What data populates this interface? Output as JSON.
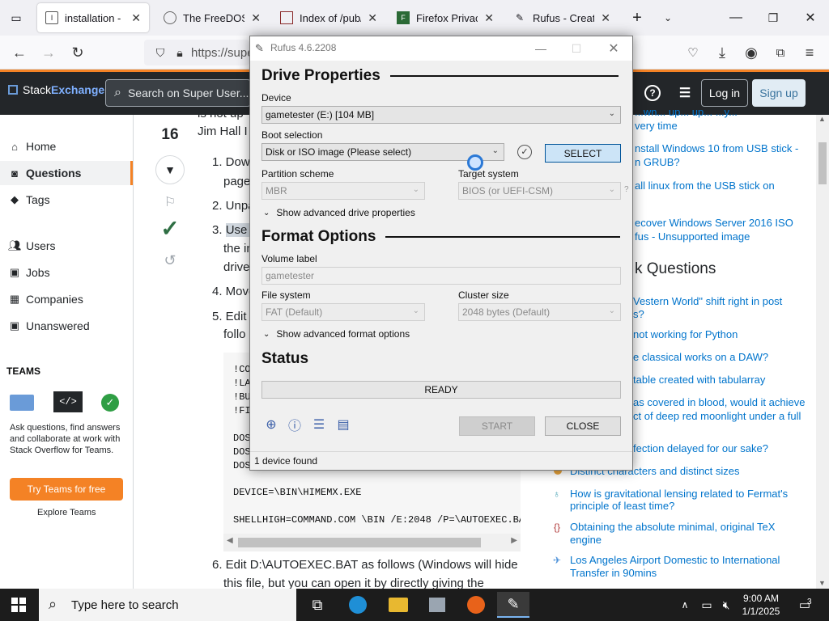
{
  "browser": {
    "tabs": [
      {
        "label": "installation - How",
        "active": true
      },
      {
        "label": "The FreeDOS Proj"
      },
      {
        "label": "Index of /pub/mi"
      },
      {
        "label": "Firefox Privacy N"
      },
      {
        "label": "Rufus - Create bo"
      }
    ],
    "url": "https://supe"
  },
  "site": {
    "brand": "Stack",
    "brand2": "Exchange",
    "search_placeholder": "Search on Super User...",
    "login": "Log in",
    "signup": "Sign up",
    "nav": {
      "home": "Home",
      "questions": "Questions",
      "tags": "Tags",
      "users": "Users",
      "jobs": "Jobs",
      "companies": "Companies",
      "unanswered": "Unanswered"
    },
    "teams": {
      "heading": "TEAMS",
      "text": "Ask questions, find answers and collaborate at work with Stack Overflow for Teams.",
      "button": "Try Teams for free",
      "explore": "Explore Teams"
    }
  },
  "question": {
    "vote_count": "16",
    "top_line1": "is not up",
    "top_line2": "Jim Hall I",
    "steps": {
      "s1a": "1. Down",
      "s1b": "page",
      "s2": "2. Unpa",
      "s3a": "3.",
      "s3sel": "Use a",
      "s3b": "the in",
      "s3c": "drive",
      "s4": "4. Move",
      "s5a": "5. Edit t",
      "s5b": "follo",
      "s6a": "6. Edit D:\\AUTOEXEC.BAT as follows (Windows will hide",
      "s6b": "this file, but you can open it by directly giving the"
    },
    "code": [
      "!CO",
      "!LA",
      "!BU",
      "!FI",
      "DOS",
      "DOS",
      "DOS",
      "DEVICE=\\BIN\\HIMEMX.EXE",
      "SHELLHIGH=COMMAND.COM \\BIN /E:2048 /P=\\AUTOEXEC.BAT"
    ]
  },
  "sidebar": {
    "related": [
      "...wn... up... up... ...y...",
      "very time",
      "nstall Windows 10 from USB stick -",
      "n GRUB?",
      "all linux from the USB stick on",
      "ecover Windows Server 2016 ISO",
      "fus - Unsupported image"
    ],
    "hot_heading": "k Questions",
    "hot": [
      "Vestern World\" shift right in post",
      "s?",
      "not working for Python",
      "e classical works on a DAW?",
      "table created with tabularray",
      "as covered in blood, would it achieve",
      "ct of deep red moonlight under a full",
      "fection delayed for our sake?",
      "Distinct characters and distinct sizes",
      "How is gravitational lensing related to Fermat's",
      "principle of least time?",
      "Obtaining the absolute minimal, original TeX",
      "engine",
      "Los Angeles Airport Domestic to International",
      "Transfer in 90mins"
    ]
  },
  "rufus": {
    "title": "Rufus 4.6.2208",
    "drive_properties": "Drive Properties",
    "device_label": "Device",
    "device_value": "gametester (E:) [104 MB]",
    "boot_label": "Boot selection",
    "boot_value": "Disk or ISO image (Please select)",
    "select_button": "SELECT",
    "partition_label": "Partition scheme",
    "partition_value": "MBR",
    "target_label": "Target system",
    "target_value": "BIOS (or UEFI-CSM)",
    "adv_drive": "Show advanced drive properties",
    "format_options": "Format Options",
    "volume_label": "Volume label",
    "volume_value": "gametester",
    "fs_label": "File system",
    "fs_value": "FAT (Default)",
    "cluster_label": "Cluster size",
    "cluster_value": "2048 bytes (Default)",
    "adv_format": "Show advanced format options",
    "status_heading": "Status",
    "status_value": "READY",
    "start_button": "START",
    "close_button": "CLOSE",
    "footer": "1 device found"
  },
  "taskbar": {
    "search_placeholder": "Type here to search",
    "time": "9:00 AM",
    "date": "1/1/2025",
    "notification_count": "3"
  },
  "colors": {
    "se_orange": "#f48225",
    "link_blue": "#0074cc",
    "accept_green": "#2f6f44"
  }
}
